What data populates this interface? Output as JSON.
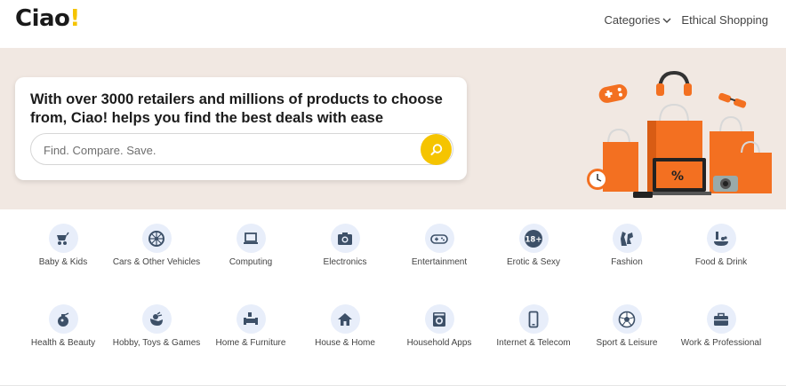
{
  "header": {
    "logo_text": "Ciao",
    "logo_bang": "!",
    "nav": [
      {
        "label": "Categories",
        "icon": "chevron-down-icon"
      },
      {
        "label": "Ethical Shopping"
      }
    ]
  },
  "hero": {
    "headline": "With over 3000 retailers and millions of products to choose from, Ciao! helps you find the best deals with ease",
    "search": {
      "placeholder": "Find. Compare. Save.",
      "value": "",
      "button_icon": "search-icon"
    },
    "image": "shopping-bags-illustration"
  },
  "categories": [
    {
      "label": "Baby & Kids",
      "icon": "stroller-icon"
    },
    {
      "label": "Cars & Other Vehicles",
      "icon": "wheel-icon"
    },
    {
      "label": "Computing",
      "icon": "laptop-icon"
    },
    {
      "label": "Electronics",
      "icon": "camera-icon"
    },
    {
      "label": "Entertainment",
      "icon": "gamepad-icon"
    },
    {
      "label": "Erotic & Sexy",
      "icon": "18-plus-icon"
    },
    {
      "label": "Fashion",
      "icon": "dress-icon"
    },
    {
      "label": "Food & Drink",
      "icon": "food-icon"
    },
    {
      "label": "Health & Beauty",
      "icon": "perfume-icon"
    },
    {
      "label": "Hobby, Toys & Games",
      "icon": "toy-icon"
    },
    {
      "label": "Home & Furniture",
      "icon": "sofa-icon"
    },
    {
      "label": "House & Home",
      "icon": "house-icon"
    },
    {
      "label": "Household Apps",
      "icon": "washing-machine-icon"
    },
    {
      "label": "Internet & Telecom",
      "icon": "phone-icon"
    },
    {
      "label": "Sport & Leisure",
      "icon": "football-icon"
    },
    {
      "label": "Work & Professional",
      "icon": "briefcase-icon"
    }
  ],
  "colors": {
    "accent": "#f5c400",
    "hero_bg": "#f1e8e2",
    "icon_bg": "#e8eefa",
    "icon_fg": "#3d5068",
    "bag_orange": "#f37021"
  }
}
